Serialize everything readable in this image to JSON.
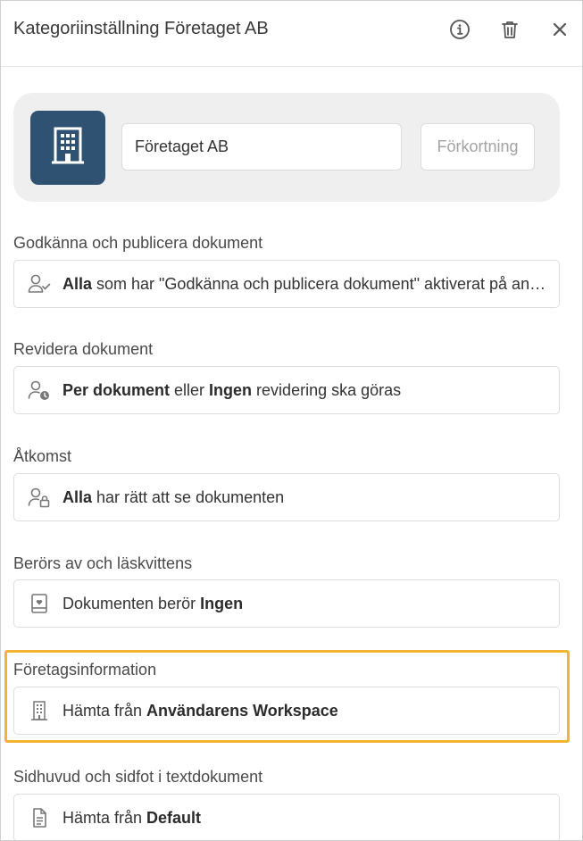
{
  "header": {
    "title": "Kategoriinställning Företaget AB"
  },
  "company": {
    "name": "Företaget AB",
    "abbreviation_placeholder": "Förkortning",
    "logo_color": "#2f5272"
  },
  "sections": [
    {
      "label": "Godkänna och publicera dokument",
      "icon": "user-check-icon",
      "bold1": "Alla",
      "text1": " som har \"Godkänna och publicera dokument\" aktiverat på användaren",
      "bold2": "",
      "text2": ""
    },
    {
      "label": "Revidera dokument",
      "icon": "user-clock-icon",
      "bold1": "Per dokument",
      "text1": " eller ",
      "bold2": "Ingen",
      "text2": " revidering ska göras"
    },
    {
      "label": "Åtkomst",
      "icon": "user-lock-icon",
      "bold1": "Alla",
      "text1": " har rätt att se dokumenten",
      "bold2": "",
      "text2": ""
    },
    {
      "label": "Berörs av och läskvittens",
      "icon": "document-heart-icon",
      "bold1": "",
      "text1": "Dokumenten berör ",
      "bold2": "Ingen",
      "text2": ""
    },
    {
      "label": "Företagsinformation",
      "icon": "building-icon",
      "bold1": "",
      "text1": "Hämta från ",
      "bold2": "Användarens Workspace",
      "text2": ""
    },
    {
      "label": "Sidhuvud och sidfot i textdokument",
      "icon": "document-icon",
      "bold1": "",
      "text1": "Hämta från ",
      "bold2": "Default",
      "text2": ""
    }
  ],
  "highlight_color": "#f5b335"
}
